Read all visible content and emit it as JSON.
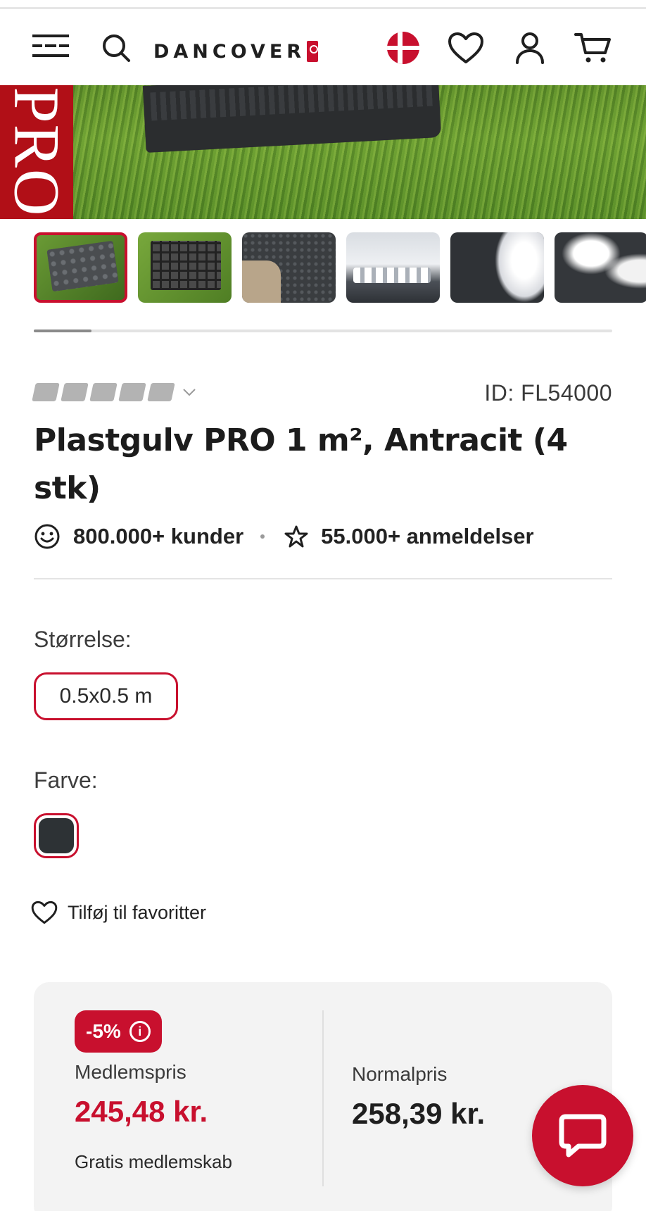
{
  "header": {
    "logo_text": "DANCOVER",
    "icons": [
      "menu-icon",
      "search-icon",
      "flag-dk-icon",
      "heart-icon",
      "user-icon",
      "cart-icon"
    ]
  },
  "hero": {
    "badge_text": "PRO"
  },
  "gallery": {
    "thumbnail_count": 6,
    "active_index": 0
  },
  "product": {
    "id_label": "ID: FL54000",
    "title": "Plastgulv PRO 1 m², Antracit (4 stk)",
    "customers": "800.000+ kunder",
    "reviews": "55.000+ anmeldelser"
  },
  "options": {
    "size_label": "Størrelse:",
    "size_value": "0.5x0.5 m",
    "color_label": "Farve:",
    "color_value_hex": "#2d3235"
  },
  "favorites": {
    "label": "Tilføj til favoritter"
  },
  "pricing": {
    "discount": "-5%",
    "member_label": "Medlemspris",
    "member_price": "245,48 kr.",
    "member_note": "Gratis medlemskab",
    "normal_label": "Normalpris",
    "normal_price": "258,39 kr."
  },
  "colors": {
    "accent": "#c8102e",
    "text": "#1f1f1f",
    "panel": "#f3f3f3"
  }
}
